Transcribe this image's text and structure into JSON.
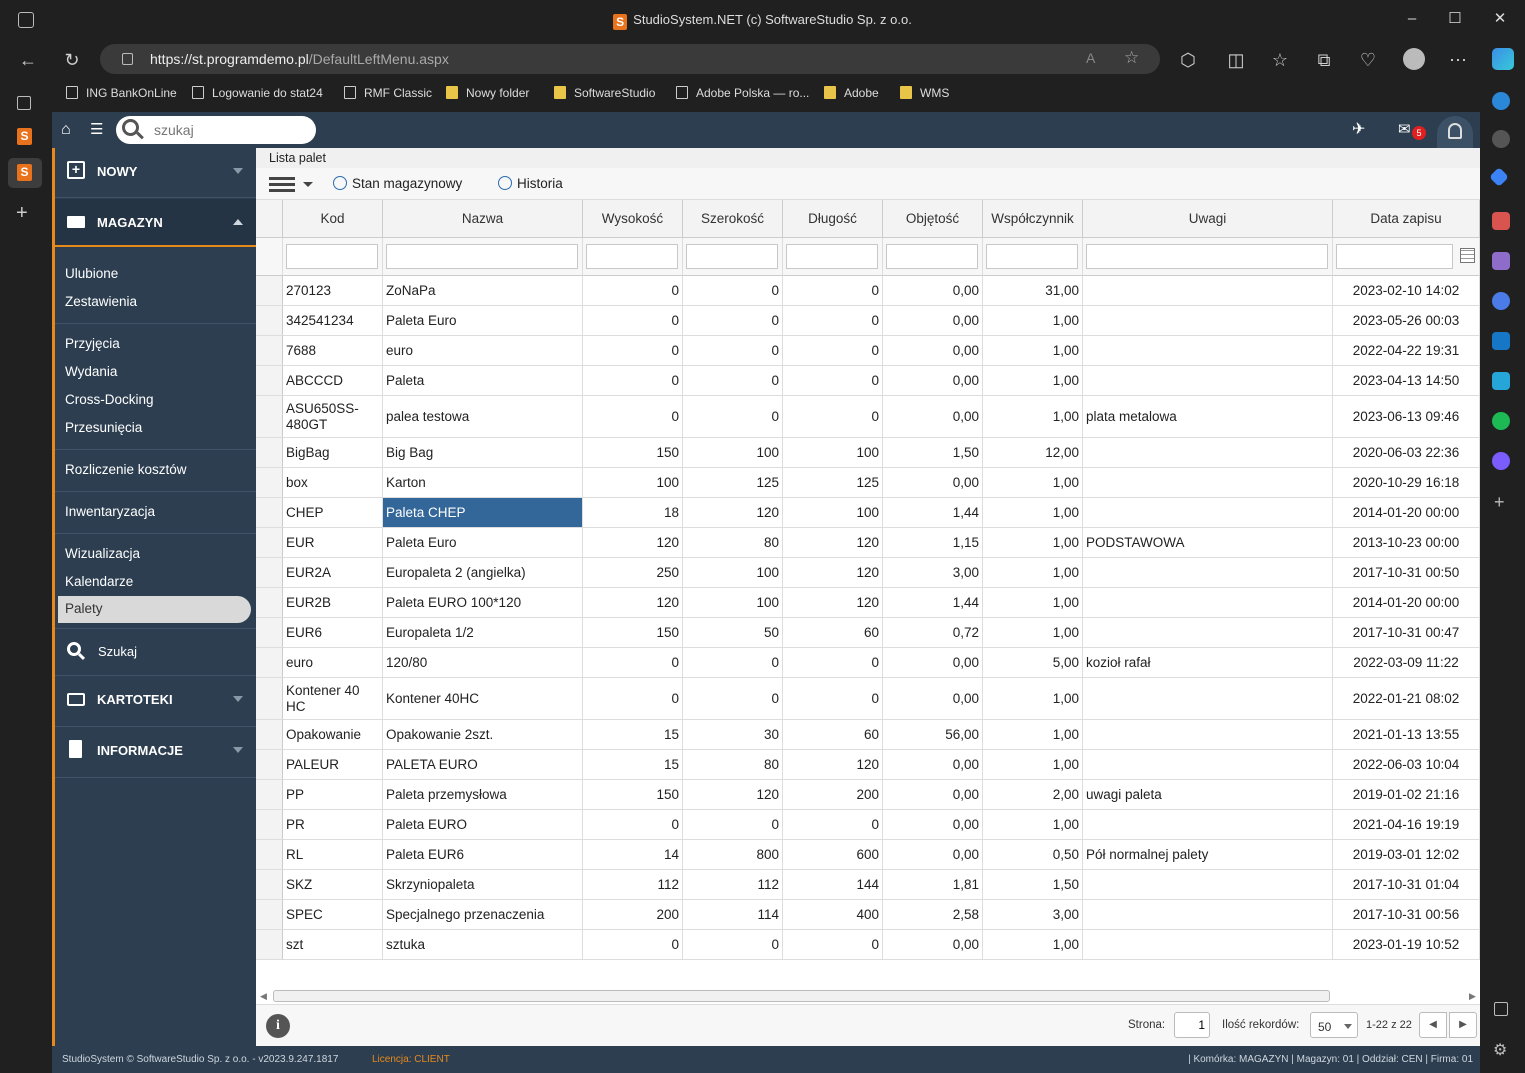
{
  "browser": {
    "window_title": "StudioSystem.NET (c) SoftwareStudio Sp. z o.o.",
    "url_host": "https://st.programdemo.pl",
    "url_path": "/DefaultLeftMenu.aspx",
    "bookmarks": [
      {
        "label": "ING BankOnLine",
        "type": "page"
      },
      {
        "label": "Logowanie do stat24",
        "type": "page"
      },
      {
        "label": "RMF Classic",
        "type": "page"
      },
      {
        "label": "Nowy folder",
        "type": "folder"
      },
      {
        "label": "SoftwareStudio",
        "type": "folder"
      },
      {
        "label": "Adobe Polska — ro...",
        "type": "page"
      },
      {
        "label": "Adobe",
        "type": "folder"
      },
      {
        "label": "WMS",
        "type": "folder"
      }
    ]
  },
  "app": {
    "search_placeholder": "szukaj",
    "mail_badge": "5",
    "menu": {
      "nowy": "NOWY",
      "magazyn": "MAGAZYN",
      "items": [
        "Ulubione",
        "Zestawienia",
        "Przyjęcia",
        "Wydania",
        "Cross-Docking",
        "Przesunięcia",
        "Rozliczenie kosztów",
        "Inwentaryzacja",
        "Wizualizacja",
        "Kalendarze",
        "Palety"
      ],
      "szukaj": "Szukaj",
      "kartoteki": "KARTOTEKI",
      "informacje": "INFORMACJE"
    },
    "breadcrumb": "Lista palet",
    "toolbar": {
      "stan": "Stan magazynowy",
      "historia": "Historia"
    },
    "columns": [
      "Kod",
      "Nazwa",
      "Wysokość",
      "Szerokość",
      "Długość",
      "Objętość",
      "Współczynnik",
      "Uwagi",
      "Data zapisu"
    ],
    "rows": [
      [
        "270123",
        "ZoNaPa",
        "0",
        "0",
        "0",
        "0,00",
        "31,00",
        "",
        "2023-02-10 14:02"
      ],
      [
        "342541234",
        "Paleta Euro",
        "0",
        "0",
        "0",
        "0,00",
        "1,00",
        "",
        "2023-05-26 00:03"
      ],
      [
        "7688",
        "euro",
        "0",
        "0",
        "0",
        "0,00",
        "1,00",
        "",
        "2022-04-22 19:31"
      ],
      [
        "ABCCCD",
        "Paleta",
        "0",
        "0",
        "0",
        "0,00",
        "1,00",
        "",
        "2023-04-13 14:50"
      ],
      [
        "ASU650SS-480GT",
        "palea testowa",
        "0",
        "0",
        "0",
        "0,00",
        "1,00",
        "plata metalowa",
        "2023-06-13 09:46"
      ],
      [
        "BigBag",
        "Big Bag",
        "150",
        "100",
        "100",
        "1,50",
        "12,00",
        "",
        "2020-06-03 22:36"
      ],
      [
        "box",
        "Karton",
        "100",
        "125",
        "125",
        "0,00",
        "1,00",
        "",
        "2020-10-29 16:18"
      ],
      [
        "CHEP",
        "Paleta CHEP",
        "18",
        "120",
        "100",
        "1,44",
        "1,00",
        "",
        "2014-01-20 00:00"
      ],
      [
        "EUR",
        "Paleta Euro",
        "120",
        "80",
        "120",
        "1,15",
        "1,00",
        "PODSTAWOWA",
        "2013-10-23 00:00"
      ],
      [
        "EUR2A",
        "Europaleta 2 (angielka)",
        "250",
        "100",
        "120",
        "3,00",
        "1,00",
        "",
        "2017-10-31 00:50"
      ],
      [
        "EUR2B",
        "Paleta EURO 100*120",
        "120",
        "100",
        "120",
        "1,44",
        "1,00",
        "",
        "2014-01-20 00:00"
      ],
      [
        "EUR6",
        "Europaleta 1/2",
        "150",
        "50",
        "60",
        "0,72",
        "1,00",
        "",
        "2017-10-31 00:47"
      ],
      [
        "euro",
        "120/80",
        "0",
        "0",
        "0",
        "0,00",
        "5,00",
        "kozioł rafał",
        "2022-03-09 11:22"
      ],
      [
        "Kontener 40HC",
        "Kontener 40HC",
        "0",
        "0",
        "0",
        "0,00",
        "1,00",
        "",
        "2022-01-21 08:02"
      ],
      [
        "Opakowanie",
        "Opakowanie 2szt.",
        "15",
        "30",
        "60",
        "56,00",
        "1,00",
        "",
        "2021-01-13 13:55"
      ],
      [
        "PALEUR",
        "PALETA EURO",
        "15",
        "80",
        "120",
        "0,00",
        "1,00",
        "",
        "2022-06-03 10:04"
      ],
      [
        "PP",
        "Paleta przemysłowa",
        "150",
        "120",
        "200",
        "0,00",
        "2,00",
        "uwagi paleta",
        "2019-01-02 21:16"
      ],
      [
        "PR",
        "Paleta EURO",
        "0",
        "0",
        "0",
        "0,00",
        "1,00",
        "",
        "2021-04-16 19:19"
      ],
      [
        "RL",
        "Paleta EUR6",
        "14",
        "800",
        "600",
        "0,00",
        "0,50",
        "Pół normalnej palety",
        "2019-03-01 12:02"
      ],
      [
        "SKZ",
        "Skrzyniopaleta",
        "112",
        "112",
        "144",
        "1,81",
        "1,50",
        "",
        "2017-10-31 01:04"
      ],
      [
        "SPEC",
        "Specjalnego przenaczenia",
        "200",
        "114",
        "400",
        "2,58",
        "3,00",
        "",
        "2017-10-31 00:56"
      ],
      [
        "szt",
        "sztuka",
        "0",
        "0",
        "0",
        "0,00",
        "1,00",
        "",
        "2023-01-19 10:52"
      ]
    ],
    "selected_cell": {
      "row": 7,
      "col": 1
    },
    "pager": {
      "strona_label": "Strona:",
      "strona_value": "1",
      "ilosc_label": "Ilość rekordów:",
      "ilosc_value": "50",
      "range": "1-22 z 22"
    },
    "footer": {
      "copyright": "StudioSystem © SoftwareStudio Sp. z o.o. - v2023.9.247.1817",
      "licencja": "Licencja: CLIENT",
      "status": "| Komórka: MAGAZYN | Magazyn: 01 | Oddział: CEN | Firma: 01"
    }
  }
}
